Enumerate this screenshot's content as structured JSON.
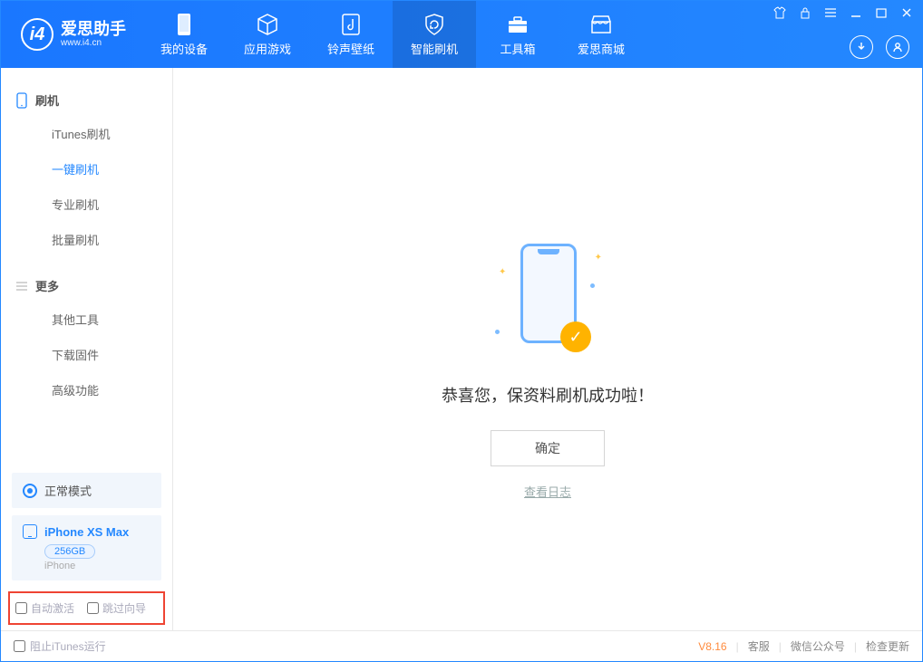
{
  "app": {
    "title": "爱思助手",
    "subtitle": "www.i4.cn"
  },
  "nav": {
    "tabs": [
      {
        "label": "我的设备"
      },
      {
        "label": "应用游戏"
      },
      {
        "label": "铃声壁纸"
      },
      {
        "label": "智能刷机"
      },
      {
        "label": "工具箱"
      },
      {
        "label": "爱思商城"
      }
    ]
  },
  "sidebar": {
    "group_flash": "刷机",
    "group_more": "更多",
    "flash_items": [
      {
        "label": "iTunes刷机"
      },
      {
        "label": "一键刷机"
      },
      {
        "label": "专业刷机"
      },
      {
        "label": "批量刷机"
      }
    ],
    "more_items": [
      {
        "label": "其他工具"
      },
      {
        "label": "下载固件"
      },
      {
        "label": "高级功能"
      }
    ],
    "mode_label": "正常模式",
    "device": {
      "name": "iPhone XS Max",
      "storage": "256GB",
      "type": "iPhone"
    },
    "checkbox_auto_activate": "自动激活",
    "checkbox_skip_guide": "跳过向导"
  },
  "main": {
    "success_text": "恭喜您，保资料刷机成功啦！",
    "ok_label": "确定",
    "view_log": "查看日志"
  },
  "footer": {
    "block_itunes": "阻止iTunes运行",
    "version": "V8.16",
    "support": "客服",
    "wechat": "微信公众号",
    "check_update": "检查更新"
  }
}
